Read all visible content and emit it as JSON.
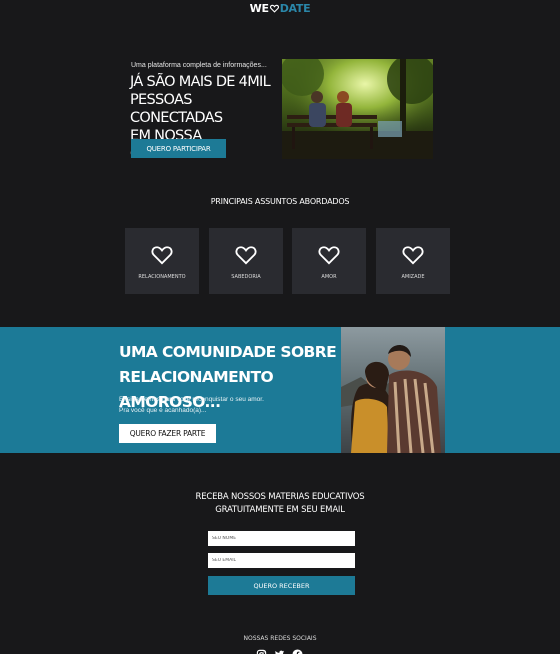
{
  "logo": {
    "we": "WE",
    "date": "DATE"
  },
  "hero": {
    "small_text": "Uma plataforma completa de informações...",
    "title_line1": "JÁ SÃO MAIS DE 4MIL",
    "title_line2": "PESSOAS CONECTADAS",
    "title_line3": "EM NOSSA COMUNIDADE",
    "button_label": "QUERO PARTICIPAR"
  },
  "topics": {
    "title": "PRINCIPAIS ASSUNTOS ABORDADOS",
    "items": [
      {
        "label": "RELACIONAMENTO",
        "icon": "heart-icon"
      },
      {
        "label": "SABEDORIA",
        "icon": "heart-icon"
      },
      {
        "label": "AMOR",
        "icon": "heart-icon"
      },
      {
        "label": "AMIZADE",
        "icon": "heart-icon"
      }
    ]
  },
  "community": {
    "title_line1": "UMA COMUNIDADE SOBRE",
    "title_line2": "RELACIONAMENTO AMOROSO...",
    "text_line1": "Ensinamentos para você reconquistar o seu amor.",
    "text_line2": "Pra você que é acanhado(a)...",
    "button_label": "QUERO FAZER PARTE"
  },
  "newsletter": {
    "title_line1": "RECEBA NOSSOS MATERIAS EDUCATIVOS",
    "title_line2": "GRATUITAMENTE EM SEU EMAIL",
    "name_placeholder": "SEU NOME",
    "email_placeholder": "SEU EMAIL",
    "button_label": "QUERO RECEBER"
  },
  "social": {
    "title": "NOSSAS REDES SOCIAIS",
    "icons": [
      "instagram-icon",
      "twitter-icon",
      "facebook-icon"
    ]
  },
  "colors": {
    "background": "#18181a",
    "accent": "#1d7a96",
    "card": "#2a2b30",
    "band": "#1c7a97"
  }
}
